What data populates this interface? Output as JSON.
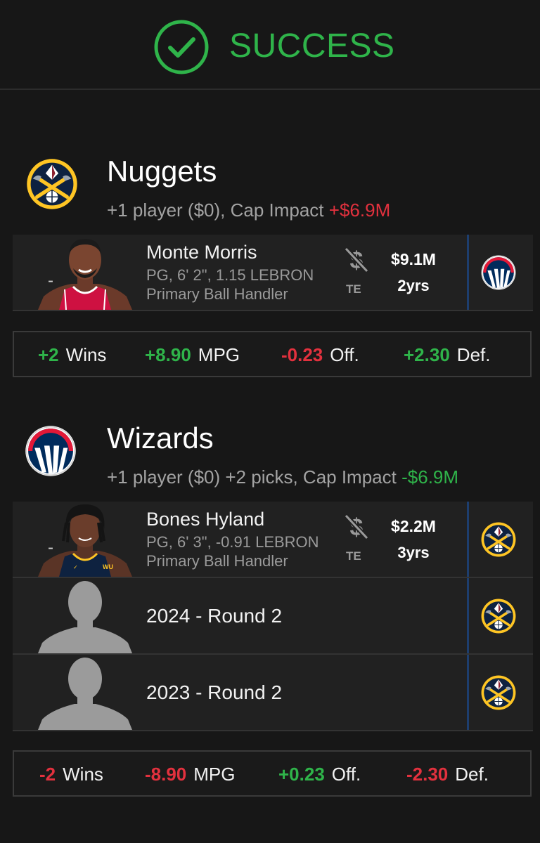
{
  "header": {
    "status": "SUCCESS"
  },
  "colors": {
    "success": "#2fb44a",
    "negative": "#e2313e",
    "nuggets_navy": "#0e2240",
    "nuggets_gold": "#fec524",
    "wizards_navy": "#002b5c",
    "wizards_red": "#e31837"
  },
  "nuggets": {
    "name": "Nuggets",
    "summary_prefix": "+1 player ($0), Cap Impact",
    "impact_sign": "+",
    "impact_value": "$6.9M",
    "players": [
      {
        "name": "Monte Morris",
        "detail": "PG, 6' 2\", 1.15 LEBRON",
        "role": "Primary Ball Handler",
        "dash": "-",
        "te": "TE",
        "salary": "$9.1M",
        "years": "2yrs"
      }
    ],
    "stats": [
      {
        "value": "+2",
        "label": "Wins"
      },
      {
        "value": "+8.90",
        "label": "MPG"
      },
      {
        "value": "-0.23",
        "label": "Off."
      },
      {
        "value": "+2.30",
        "label": "Def."
      }
    ]
  },
  "wizards": {
    "name": "Wizards",
    "summary_prefix": "+1 player ($0) +2 picks, Cap Impact",
    "impact_sign": "-",
    "impact_value": "$6.9M",
    "players": [
      {
        "name": "Bones Hyland",
        "detail": "PG, 6' 3\", -0.91 LEBRON",
        "role": "Primary Ball Handler",
        "dash": "-",
        "te": "TE",
        "salary": "$2.2M",
        "years": "3yrs"
      }
    ],
    "picks": [
      {
        "label": "2024 - Round 2"
      },
      {
        "label": "2023 - Round 2"
      }
    ],
    "stats": [
      {
        "value": "-2",
        "label": "Wins"
      },
      {
        "value": "-8.90",
        "label": "MPG"
      },
      {
        "value": "+0.23",
        "label": "Off."
      },
      {
        "value": "-2.30",
        "label": "Def."
      }
    ]
  }
}
